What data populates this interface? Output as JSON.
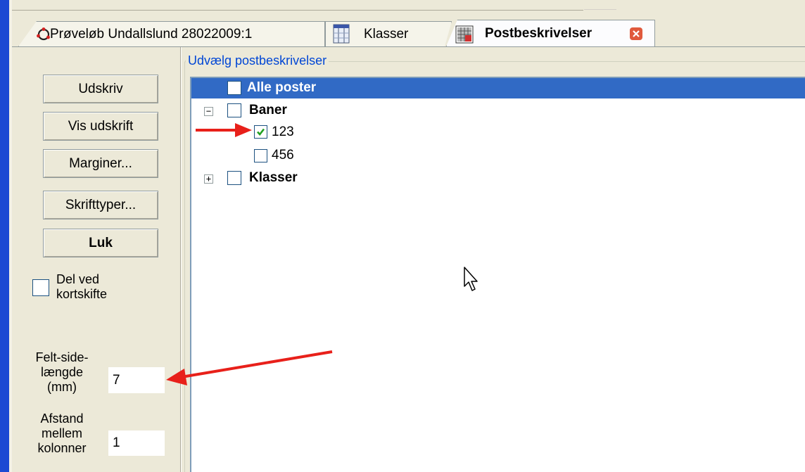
{
  "tabs": [
    {
      "label": "Prøveløb Undallslund 28022009:1",
      "icon": "map-icon",
      "active": false
    },
    {
      "label": "Klasser",
      "icon": "table-icon",
      "active": false
    },
    {
      "label": "Postbeskrivelser",
      "icon": "grid-icon",
      "active": true,
      "close_icon": "close-icon"
    }
  ],
  "left_panel": {
    "buttons": {
      "print": "Udskriv",
      "preview": "Vis udskrift",
      "margins": "Marginer...",
      "fonts": "Skrifttyper...",
      "close": "Luk"
    },
    "split_checkbox": {
      "label_line1": "Del ved",
      "label_line2": "kortskifte",
      "checked": false
    },
    "field_side": {
      "label_line1": "Felt-side-",
      "label_line2": "længde",
      "label_line3": "(mm)",
      "value": "7"
    },
    "column_gap": {
      "label_line1": "Afstand",
      "label_line2": "mellem",
      "label_line3": "kolonner",
      "value": "1"
    }
  },
  "group": {
    "title": "Udvælg postbeskrivelser"
  },
  "tree": {
    "all": {
      "label": "Alle poster",
      "checked": false,
      "selected": true
    },
    "baner": {
      "label": "Baner",
      "expanded": true,
      "checked": false,
      "children": [
        {
          "label": "123",
          "checked": true
        },
        {
          "label": "456",
          "checked": false
        }
      ]
    },
    "klasser": {
      "label": "Klasser",
      "expanded": false,
      "checked": false
    }
  },
  "colors": {
    "window_edge": "#1c49d3",
    "selection": "#316ac5",
    "group_title": "#0046d5",
    "annotation_arrow": "#e8201a",
    "check_green": "#21a121"
  },
  "annotations": [
    "arrow-to-123-checkbox",
    "arrow-to-field-side-input"
  ]
}
